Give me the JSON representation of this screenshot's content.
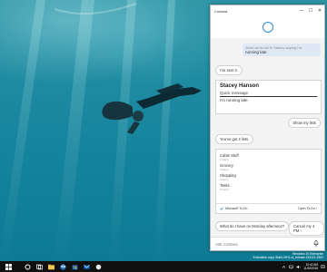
{
  "window": {
    "title": "Cortana",
    "minimize": "—",
    "maximize": "☐",
    "close": "✕"
  },
  "chat": {
    "user_message_line1": "Send an email to Stacey saying I'm",
    "user_message_line2": "running late",
    "reply_sent": "I've sent it.",
    "contact_card": {
      "name": "Stacey Hanson",
      "subject_label": "Quick message",
      "message": "I'm running late"
    },
    "user_show_lists": "Show my lists",
    "reply_lists": "You've got 4 lists.",
    "lists": [
      {
        "name": "Cable Stuff",
        "count": "2 items"
      },
      {
        "name": "Grocery",
        "count": "3 items"
      },
      {
        "name": "Shopping",
        "count": "2 items"
      },
      {
        "name": "Tasks",
        "count": "5 items"
      }
    ],
    "todo_footer": {
      "app": "Microsoft To-Do",
      "open": "Open To-Do ›"
    },
    "suggestions": [
      "What do I have on Monday afternoon?",
      "Cancel my 4 PM ›"
    ]
  },
  "ask_bar": {
    "placeholder": "Ask Cortana"
  },
  "taskbar": {
    "time": "10:42 AM",
    "date": "11/26/2018"
  },
  "watermark": {
    "line1": "Windows 10 Enterprise",
    "line2": "Evaluation copy. Build 19H1.rs_release.181121-1802"
  },
  "colors": {
    "accent": "#2b88d8",
    "taskbar": "#101010",
    "water": "#1f8ba1"
  }
}
